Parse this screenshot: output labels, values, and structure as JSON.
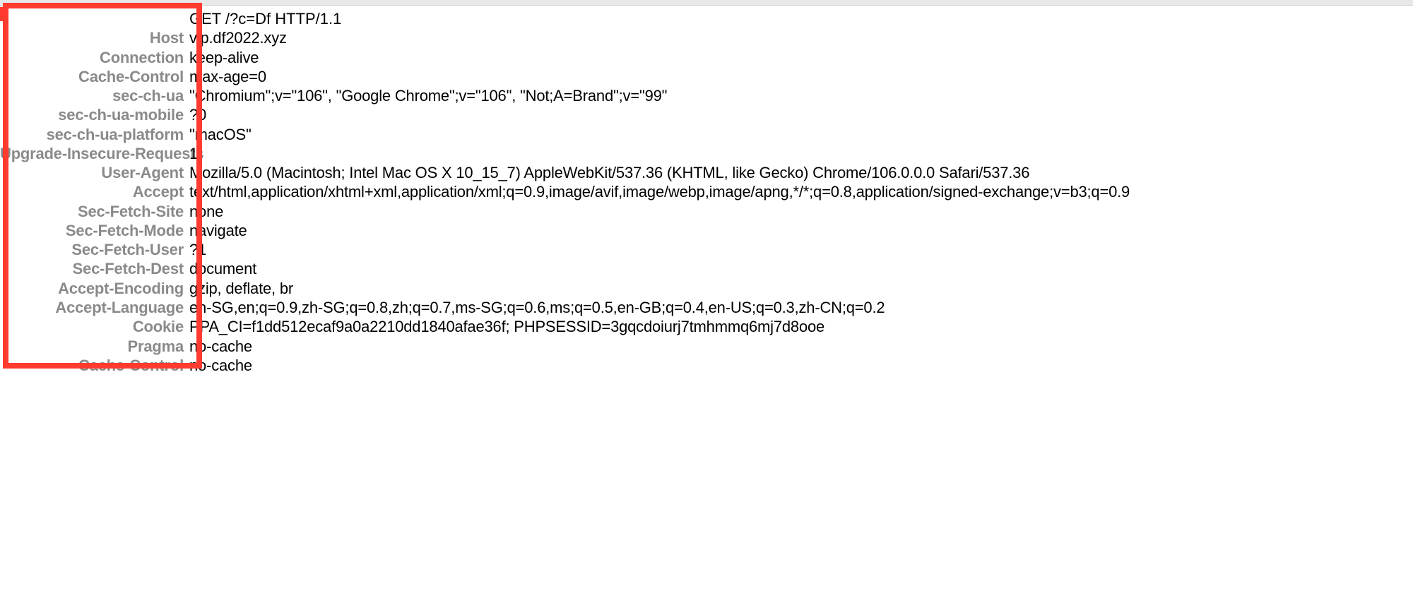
{
  "request_line": "GET /?c=Df HTTP/1.1",
  "headers": [
    {
      "name": "Host",
      "value": "vip.df2022.xyz"
    },
    {
      "name": "Connection",
      "value": "keep-alive"
    },
    {
      "name": "Cache-Control",
      "value": "max-age=0"
    },
    {
      "name": "sec-ch-ua",
      "value": "\"Chromium\";v=\"106\", \"Google Chrome\";v=\"106\", \"Not;A=Brand\";v=\"99\""
    },
    {
      "name": "sec-ch-ua-mobile",
      "value": "?0"
    },
    {
      "name": "sec-ch-ua-platform",
      "value": "\"macOS\""
    },
    {
      "name": "Upgrade-Insecure-Requests",
      "value": "1"
    },
    {
      "name": "User-Agent",
      "value": "Mozilla/5.0 (Macintosh; Intel Mac OS X 10_15_7) AppleWebKit/537.36 (KHTML, like Gecko) Chrome/106.0.0.0 Safari/537.36"
    },
    {
      "name": "Accept",
      "value": "text/html,application/xhtml+xml,application/xml;q=0.9,image/avif,image/webp,image/apng,*/*;q=0.8,application/signed-exchange;v=b3;q=0.9"
    },
    {
      "name": "Sec-Fetch-Site",
      "value": "none"
    },
    {
      "name": "Sec-Fetch-Mode",
      "value": "navigate"
    },
    {
      "name": "Sec-Fetch-User",
      "value": "?1"
    },
    {
      "name": "Sec-Fetch-Dest",
      "value": "document"
    },
    {
      "name": "Accept-Encoding",
      "value": "gzip, deflate, br"
    },
    {
      "name": "Accept-Language",
      "value": "en-SG,en;q=0.9,zh-SG;q=0.8,zh;q=0.7,ms-SG;q=0.6,ms;q=0.5,en-GB;q=0.4,en-US;q=0.3,zh-CN;q=0.2"
    },
    {
      "name": "Cookie",
      "value": "PPA_CI=f1dd512ecaf9a0a2210dd1840afae36f; PHPSESSID=3gqcdoiurj7tmhmmq6mj7d8ooe"
    },
    {
      "name": "Pragma",
      "value": "no-cache"
    },
    {
      "name": "Cache-Control",
      "value": "no-cache"
    }
  ]
}
